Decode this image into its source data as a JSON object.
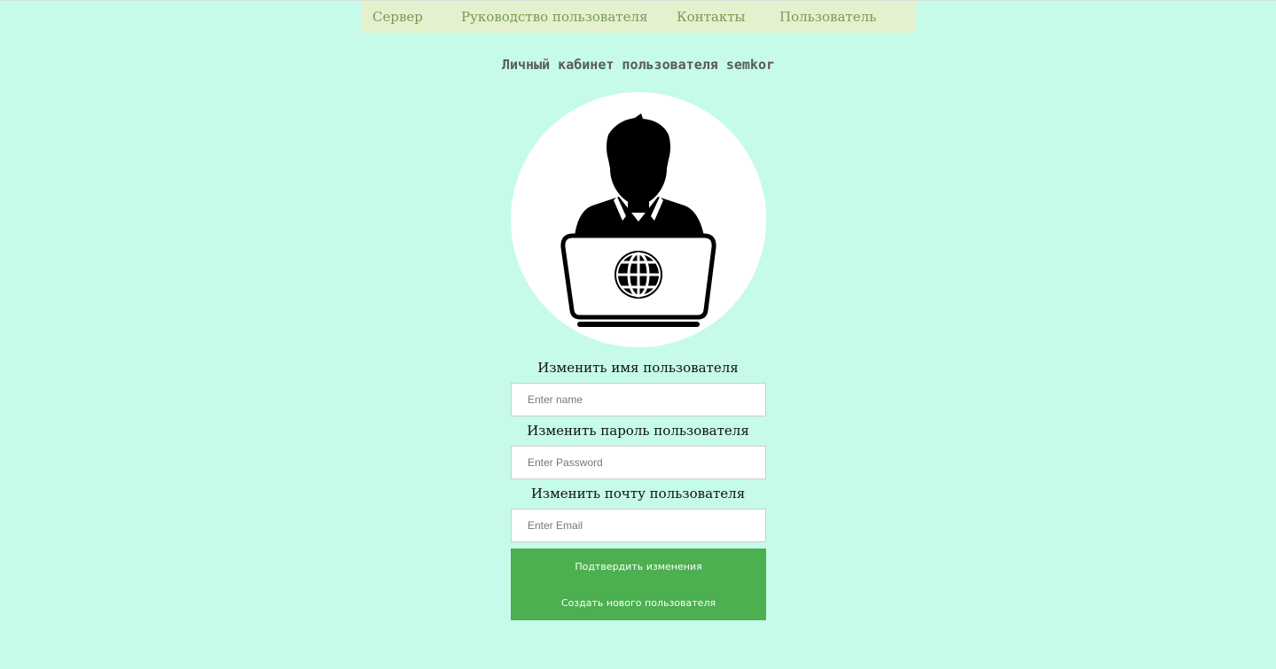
{
  "nav": {
    "items": [
      {
        "label": "Сервер"
      },
      {
        "label": "Руководство пользователя"
      },
      {
        "label": "Контакты"
      },
      {
        "label": "Пользователь"
      }
    ],
    "background": "#e3f1cf",
    "text_color": "#799958"
  },
  "page": {
    "title": "Личный кабинет пользователя semkor",
    "background": "#c6fbe9"
  },
  "avatar": {
    "icon": "user-at-laptop-globe-icon"
  },
  "form": {
    "name_label": "Изменить имя пользователя",
    "name_placeholder": "Enter name",
    "password_label": "Изменить пароль пользователя",
    "password_placeholder": "Enter Password",
    "email_label": "Изменить почту пользователя",
    "email_placeholder": "Enter Email"
  },
  "buttons": {
    "confirm_label": "Подтвердить изменения",
    "create_user_label": "Создать нового пользователя",
    "color": "#4caf50"
  }
}
